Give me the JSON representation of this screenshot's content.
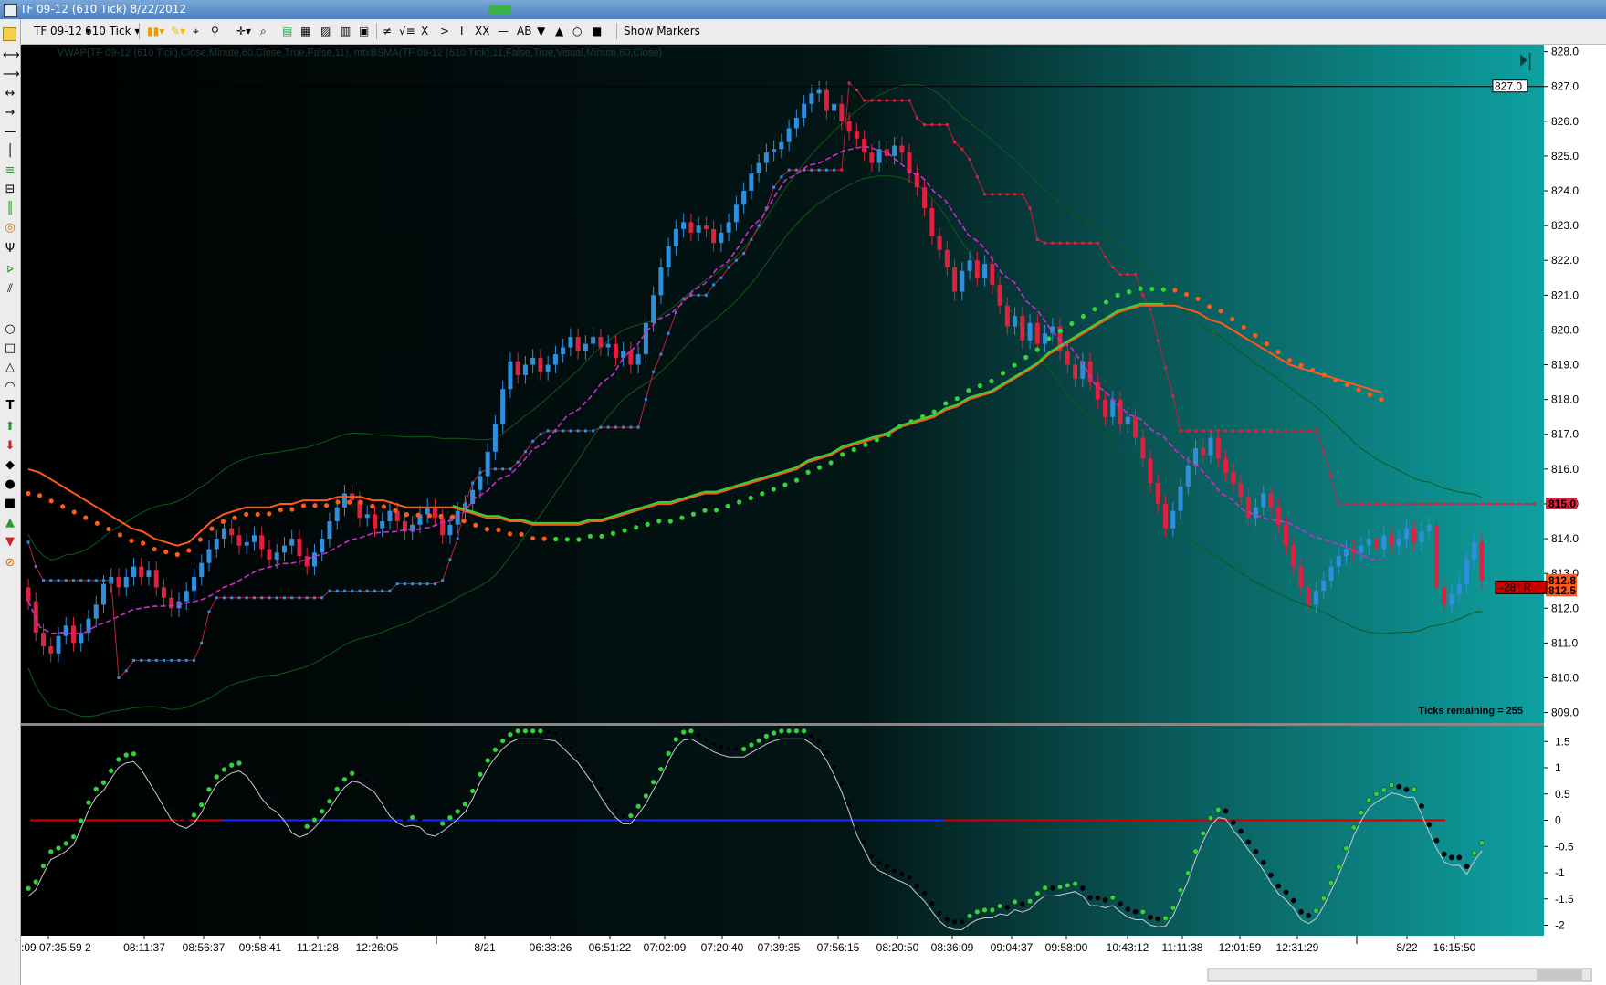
{
  "window": {
    "title": "TF 09-12 (610 Tick)  8/22/2012"
  },
  "toolbar": {
    "instrument": "TF 09-12",
    "interval": "610 Tick",
    "symbols": [
      "≠",
      "√≡",
      "X",
      ">",
      "I",
      "XX",
      "—",
      "AB",
      "▼",
      "▲",
      "■"
    ],
    "show_markers": "Show Markers"
  },
  "indicator_title": "VWAP(TF 09-12 (610 Tick),Close,Minute,60,Close,True,False,11), mtxBSMA(TF 09-12 (610 Tick),11,False,True,Visual,Minute,60,Close)",
  "ticks_remaining": "Ticks remaining = 255",
  "colors": {
    "bull": "#2f8fdd",
    "bear": "#e0203f",
    "green": "#34d33a",
    "orange": "#ff5a1a",
    "magenta": "#cc2ccc",
    "panel_gradient_start": "#000000",
    "panel_gradient_end": "#0e9c9c"
  },
  "price_panel": {
    "y_ticks": [
      "828.0",
      "827.0",
      "826.0",
      "825.0",
      "824.0",
      "823.0",
      "822.0",
      "821.0",
      "820.0",
      "819.0",
      "818.0",
      "817.0",
      "816.0",
      "815.0",
      "814.0",
      "813.0",
      "812.0",
      "811.0",
      "810.0",
      "809.0"
    ],
    "last_price_label": "827.0",
    "price_flags": [
      {
        "label": "815.0",
        "value": 815.0,
        "color": "#e0203f"
      },
      {
        "label": "812.8",
        "value": 812.8,
        "color": "#ff5a1a"
      },
      {
        "label": "812.5",
        "value": 812.5,
        "color": "#ff5a1a"
      }
    ],
    "drawing_label": "-28°  R"
  },
  "oscillator_panel": {
    "y_ticks": [
      "1.5",
      "1",
      "0.5",
      "0",
      "-0.5",
      "-1",
      "-1.5",
      "-2"
    ]
  },
  "time_labels": [
    ":20:09 07:35:59 2",
    "08:11:37",
    "08:56:37",
    "09:58:41",
    "11:21:28",
    "12:26:05",
    "8/21",
    "06:33:26",
    "06:51:22",
    "07:02:09",
    "07:20:40",
    "07:39:35",
    "07:56:15",
    "08:20:50",
    "08:36:09",
    "09:04:37",
    "09:58:00",
    "10:43:12",
    "11:11:38",
    "12:01:59",
    "12:31:29",
    "8/22",
    "16:15:50"
  ],
  "chart_data": {
    "type": "candlestick",
    "instrument": "TF 09-12",
    "interval": "610 Tick",
    "ylim": [
      808.7,
      828.2
    ],
    "candles_close_series": [
      812.2,
      811.3,
      810.9,
      810.7,
      811.2,
      811.5,
      811.0,
      811.3,
      811.7,
      812.1,
      812.7,
      812.9,
      812.6,
      812.9,
      813.2,
      812.9,
      813.1,
      812.6,
      812.3,
      812.0,
      812.2,
      812.5,
      812.9,
      813.3,
      813.7,
      814.0,
      814.3,
      814.1,
      813.8,
      813.9,
      814.1,
      813.7,
      813.4,
      813.6,
      813.8,
      814.0,
      813.5,
      813.2,
      813.6,
      814.0,
      814.5,
      814.9,
      815.3,
      815.1,
      814.6,
      814.7,
      814.3,
      814.5,
      814.8,
      814.5,
      814.2,
      814.4,
      814.7,
      814.9,
      814.6,
      814.1,
      814.4,
      814.8,
      815.0,
      815.4,
      815.8,
      816.5,
      817.3,
      818.3,
      819.1,
      818.7,
      819.0,
      819.2,
      818.8,
      819.0,
      819.3,
      819.5,
      819.8,
      819.4,
      819.6,
      819.8,
      819.5,
      819.6,
      819.2,
      819.4,
      819.0,
      819.3,
      820.2,
      821.0,
      821.8,
      822.4,
      822.9,
      823.1,
      822.8,
      823.0,
      822.9,
      822.5,
      822.8,
      823.1,
      823.6,
      824.0,
      824.5,
      824.8,
      825.1,
      825.2,
      825.4,
      825.8,
      826.1,
      826.5,
      826.8,
      826.9,
      826.3,
      826.5,
      826.0,
      825.7,
      825.5,
      825.1,
      824.8,
      825.2,
      825.0,
      825.3,
      825.1,
      824.5,
      824.1,
      823.5,
      822.7,
      822.3,
      821.8,
      821.1,
      821.7,
      822.0,
      821.5,
      821.9,
      821.3,
      820.7,
      820.1,
      820.4,
      819.7,
      820.2,
      819.6,
      819.9,
      820.1,
      819.4,
      819.0,
      818.6,
      819.1,
      818.5,
      818.0,
      817.5,
      818.0,
      817.3,
      817.5,
      816.9,
      816.3,
      815.6,
      815.0,
      814.3,
      814.8,
      815.5,
      816.1,
      816.6,
      816.4,
      816.9,
      816.3,
      815.9,
      815.6,
      815.2,
      814.6,
      814.9,
      815.3,
      814.9,
      814.4,
      813.8,
      813.2,
      812.6,
      812.1,
      812.5,
      812.8,
      813.2,
      813.5,
      813.7,
      813.6,
      813.8,
      814.0,
      813.7,
      814.1,
      813.8,
      814.0,
      814.3,
      813.9,
      814.2,
      814.4,
      812.6,
      812.1,
      812.4,
      812.7,
      813.4,
      813.9,
      812.8
    ],
    "trailing_stop": [
      813.9,
      813.2,
      812.8,
      812.8,
      812.8,
      812.8,
      812.8,
      812.8,
      812.8,
      812.8,
      812.8,
      812.8,
      810.0,
      810.2,
      810.5,
      810.5,
      810.5,
      810.5,
      810.5,
      810.5,
      810.5,
      810.5,
      810.5,
      811.0,
      811.9,
      812.3,
      812.3,
      812.3,
      812.3,
      812.3,
      812.3,
      812.3,
      812.3,
      812.3,
      812.3,
      812.3,
      812.3,
      812.3,
      812.3,
      812.3,
      812.5,
      812.5,
      812.5,
      812.5,
      812.5,
      812.5,
      812.5,
      812.5,
      812.5,
      812.7,
      812.7,
      812.7,
      812.7,
      812.7,
      812.7,
      812.8,
      813.4,
      814.0,
      815.0,
      815.6,
      815.9,
      816.0,
      816.0,
      816.0,
      816.0,
      816.2,
      816.5,
      816.8,
      817.0,
      817.1,
      817.1,
      817.1,
      817.1,
      817.1,
      817.1,
      817.1,
      817.2,
      817.2,
      817.2,
      817.2,
      817.2,
      817.2,
      818.0,
      818.8,
      819.3,
      819.9,
      820.5,
      820.9,
      821.0,
      821.0,
      821.0,
      821.3,
      821.5,
      821.8,
      822.0,
      822.2,
      822.6,
      823.0,
      823.5,
      824.1,
      824.4,
      824.6,
      824.6,
      824.6,
      824.6,
      824.6,
      824.6,
      824.6,
      824.6,
      827.1,
      826.9,
      826.6,
      826.6,
      826.6,
      826.6,
      826.6,
      826.6,
      826.6,
      826.1,
      825.9,
      825.9,
      825.9,
      825.9,
      825.4,
      825.2,
      824.9,
      824.4,
      823.9,
      823.9,
      823.9,
      823.9,
      823.9,
      823.9,
      823.5,
      822.6,
      822.5,
      822.5,
      822.5,
      822.5,
      822.5,
      822.5,
      822.5,
      822.5,
      822.1,
      821.8,
      821.6,
      821.6,
      821.6,
      821.0,
      820.6,
      819.7,
      818.9,
      818.1,
      817.1,
      817.1,
      817.1,
      817.1,
      817.1,
      817.1,
      817.1,
      817.1,
      817.1,
      817.1,
      817.1,
      817.1,
      817.1,
      817.1,
      817.1,
      817.1,
      817.1,
      817.1,
      817.1,
      816.5,
      815.8,
      815.0,
      815.0,
      815.0,
      815.0,
      815.0,
      815.0,
      815.0,
      815.0,
      815.0,
      815.0,
      815.0,
      815.0,
      815.0,
      815.0,
      815.0,
      815.0,
      815.0,
      815.0,
      815.0,
      815.0,
      815.0,
      815.0,
      815.0,
      815.0,
      815.0,
      815.0,
      815.0
    ],
    "vwap_orange": [
      816.0,
      815.9,
      815.7,
      815.5,
      815.3,
      815.1,
      814.9,
      814.7,
      814.5,
      814.3,
      814.2,
      814.0,
      813.9,
      813.8,
      813.9,
      814.2,
      814.5,
      814.7,
      814.8,
      814.9,
      814.9,
      814.9,
      815.0,
      815.0,
      815.1,
      815.1,
      815.1,
      815.2,
      815.2,
      815.2,
      815.1,
      815.1,
      815.0,
      814.9,
      814.9,
      814.9,
      814.9,
      814.9,
      814.8,
      814.7,
      814.6,
      814.6,
      814.5,
      814.5,
      814.4,
      814.4,
      814.4,
      814.4,
      814.4,
      814.5,
      814.5,
      814.6,
      814.7,
      814.8,
      814.9,
      815.0,
      815.0,
      815.1,
      815.2,
      815.3,
      815.3,
      815.4,
      815.5,
      815.6,
      815.7,
      815.8,
      815.9,
      816.0,
      816.2,
      816.3,
      816.4,
      816.6,
      816.7,
      816.8,
      816.9,
      817.0,
      817.2,
      817.3,
      817.4,
      817.5,
      817.7,
      817.8,
      818.0,
      818.1,
      818.2,
      818.4,
      818.6,
      818.8,
      819.0,
      819.3,
      819.5,
      819.7,
      819.9,
      820.1,
      820.3,
      820.5,
      820.6,
      820.7,
      820.7,
      820.7,
      820.7,
      820.6,
      820.5,
      820.3,
      820.2,
      820.0,
      819.8,
      819.6,
      819.4,
      819.2,
      819.0,
      818.9,
      818.8,
      818.7,
      818.6,
      818.5,
      818.4,
      818.3,
      818.2
    ],
    "oscillator_ylim": [
      -2.2,
      1.8
    ]
  }
}
